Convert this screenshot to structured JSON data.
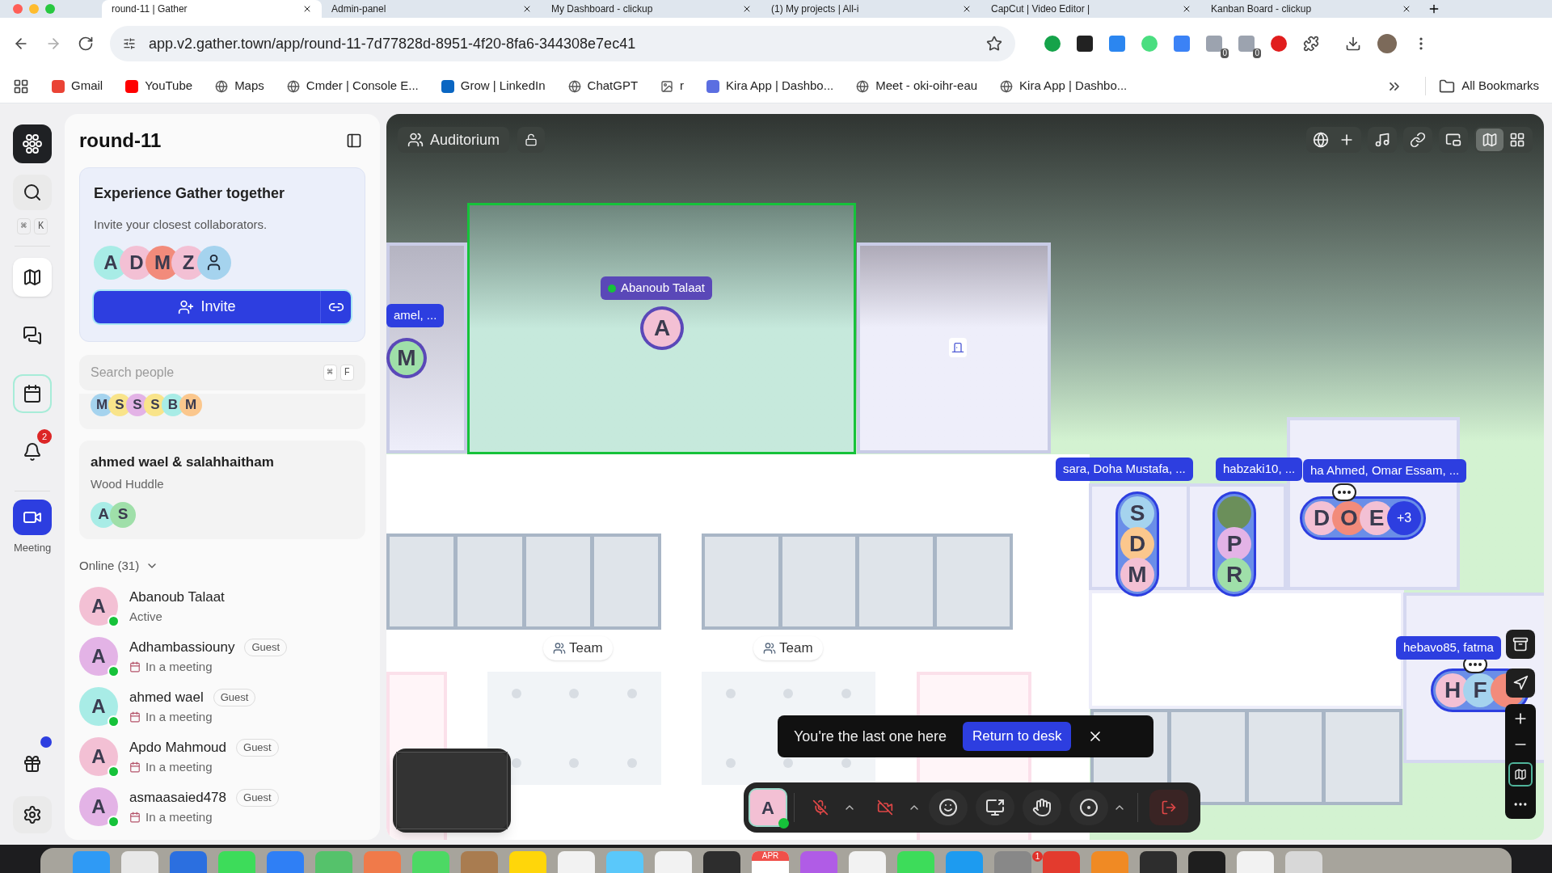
{
  "browser": {
    "tabs": [
      {
        "title": "round-11 | Gather",
        "selected": true
      },
      {
        "title": "Admin-panel",
        "selected": false
      },
      {
        "title": "My Dashboard - clickup",
        "selected": false
      },
      {
        "title": "(1) My projects | All-i",
        "selected": false
      },
      {
        "title": "CapCut | Video Editor |",
        "selected": false
      },
      {
        "title": "Kanban Board - clickup",
        "selected": false
      }
    ],
    "url": "app.v2.gather.town/app/round-11-7d77828d-8951-4f20-8fa6-344308e7ec41",
    "extension_badges": [
      "0",
      "0"
    ],
    "bookmarks": [
      {
        "label": "Gmail",
        "kind": "gmail"
      },
      {
        "label": "YouTube",
        "kind": "youtube"
      },
      {
        "label": "Maps",
        "kind": "globe"
      },
      {
        "label": "Cmder | Console E...",
        "kind": "globe"
      },
      {
        "label": "Grow | LinkedIn",
        "kind": "linkedin"
      },
      {
        "label": "ChatGPT",
        "kind": "globe"
      },
      {
        "label": "r",
        "kind": "image"
      },
      {
        "label": "Kira App | Dashbo...",
        "kind": "kira"
      },
      {
        "label": "Meet - oki-oihr-eau",
        "kind": "globe"
      },
      {
        "label": "Kira App | Dashbo...",
        "kind": "globe"
      }
    ],
    "all_bookmarks": "All Bookmarks"
  },
  "rail": {
    "search_keys": [
      "⌘",
      "K"
    ],
    "nav": [
      {
        "kind": "map",
        "selected": true
      },
      {
        "kind": "chat",
        "selected": false
      },
      {
        "kind": "calendar",
        "selected": false
      },
      {
        "kind": "bell",
        "selected": false,
        "badge": "2"
      }
    ],
    "meeting": {
      "label": "Meeting",
      "on": true
    }
  },
  "sidebar": {
    "title": "round-11",
    "promo": {
      "title": "Experience Gather together",
      "subtitle": "Invite your closest collaborators.",
      "avatars": [
        {
          "kind": "letter",
          "letter": "A",
          "color": "#a8ece6"
        },
        {
          "kind": "letter",
          "letter": "D",
          "color": "#f3c0d4"
        },
        {
          "kind": "letter",
          "letter": "M",
          "color": "#f28b7b"
        },
        {
          "kind": "letter",
          "letter": "Z",
          "color": "#f3c0d4"
        },
        {
          "kind": "person",
          "color": "#a5d3ee"
        }
      ],
      "invite": "Invite"
    },
    "search": {
      "placeholder": "Search people",
      "keys": [
        "⌘",
        "F"
      ]
    },
    "group": {
      "avatars": [
        {
          "kind": "letter",
          "letter": "M",
          "color": "#a5d3ee"
        },
        {
          "kind": "letter",
          "letter": "S",
          "color": "#f9e48a"
        },
        {
          "kind": "letter",
          "letter": "S",
          "color": "#e3b3e6"
        },
        {
          "kind": "letter",
          "letter": "S",
          "color": "#f9e48a"
        },
        {
          "kind": "letter",
          "letter": "B",
          "color": "#a8ece6"
        },
        {
          "kind": "letter",
          "letter": "M",
          "color": "#fbc78d"
        }
      ]
    },
    "huddle": {
      "title": "ahmed wael & salahhaitham",
      "subtitle": "Wood Huddle",
      "avatars": [
        {
          "kind": "letter",
          "letter": "A",
          "color": "#a8ece6"
        },
        {
          "kind": "letter",
          "letter": "S",
          "color": "#9fdfa9"
        }
      ]
    },
    "online": {
      "label": "Online (31)",
      "expanded": true,
      "people": [
        {
          "letter": "A",
          "color": "#f3c0d4",
          "name": "Abanoub Talaat",
          "status": "Active",
          "kind": "active",
          "online": true
        },
        {
          "letter": "A",
          "color": "#e3b3e6",
          "name": "Adhambassiouny",
          "badge": "Guest",
          "status": "In a meeting",
          "kind": "meeting",
          "online": true
        },
        {
          "letter": "A",
          "color": "#a8ece6",
          "name": "ahmed wael",
          "badge": "Guest",
          "status": "In a meeting",
          "kind": "meeting",
          "online": true
        },
        {
          "letter": "A",
          "color": "#f3c0d4",
          "name": "Apdo Mahmoud",
          "badge": "Guest",
          "status": "In a meeting",
          "kind": "meeting",
          "online": true
        },
        {
          "letter": "A",
          "color": "#e3b3e6",
          "name": "asmaasaied478",
          "badge": "Guest",
          "status": "In a meeting",
          "kind": "meeting",
          "online": true
        }
      ]
    }
  },
  "map": {
    "room": {
      "label": "Auditorium",
      "locked": false
    },
    "tags": [
      {
        "text": "amel, ...",
        "online": false
      },
      {
        "text": "Abanoub Talaat",
        "online": true
      },
      {
        "text": "sara, Doha Mustafa, ...",
        "online": false
      },
      {
        "text": "habzaki10, ...",
        "online": false
      },
      {
        "text": "ha Ahmed, Omar Essam, ...",
        "online": false
      },
      {
        "text": "hebavo85, fatma",
        "online": false
      }
    ],
    "groups": [
      {
        "chatting": false,
        "members": [
          {
            "kind": "letter",
            "letter": "M",
            "color": "#9fdfa9"
          }
        ]
      },
      {
        "chatting": false,
        "members": [
          {
            "kind": "letter",
            "letter": "A",
            "color": "#f3c0d4"
          }
        ]
      },
      {
        "chatting": false,
        "members": [
          {
            "kind": "letter",
            "letter": "S",
            "color": "#a5d3ee"
          },
          {
            "kind": "letter",
            "letter": "D",
            "color": "#fbc78d"
          },
          {
            "kind": "letter",
            "letter": "M",
            "color": "#f3c0d4"
          }
        ]
      },
      {
        "chatting": false,
        "members": [
          {
            "kind": "photo",
            "color": "#6b8f5a"
          },
          {
            "kind": "letter",
            "letter": "P",
            "color": "#e3b3e6"
          },
          {
            "kind": "letter",
            "letter": "R",
            "color": "#9fdfa9"
          }
        ]
      },
      {
        "chatting": true,
        "more": "+3",
        "members": [
          {
            "kind": "letter",
            "letter": "D",
            "color": "#f3c0d4"
          },
          {
            "kind": "letter",
            "letter": "O",
            "color": "#f28b7b"
          },
          {
            "kind": "letter",
            "letter": "E",
            "color": "#f3c0d4"
          }
        ]
      },
      {
        "chatting": true,
        "members": [
          {
            "kind": "letter",
            "letter": "H",
            "color": "#f3c0d4"
          },
          {
            "kind": "letter",
            "letter": "F",
            "color": "#a5d3ee"
          },
          {
            "kind": "covered",
            "color": "#f28b7b"
          }
        ]
      }
    ],
    "team_labels": [
      "Team",
      "Team"
    ],
    "toast": {
      "text": "You're the last one here",
      "action": "Return to desk"
    },
    "controls": {
      "avatar": "A",
      "mic_on": false,
      "camera_on": false
    }
  },
  "dock": {
    "calendar_month": "APR",
    "badge": "1"
  }
}
